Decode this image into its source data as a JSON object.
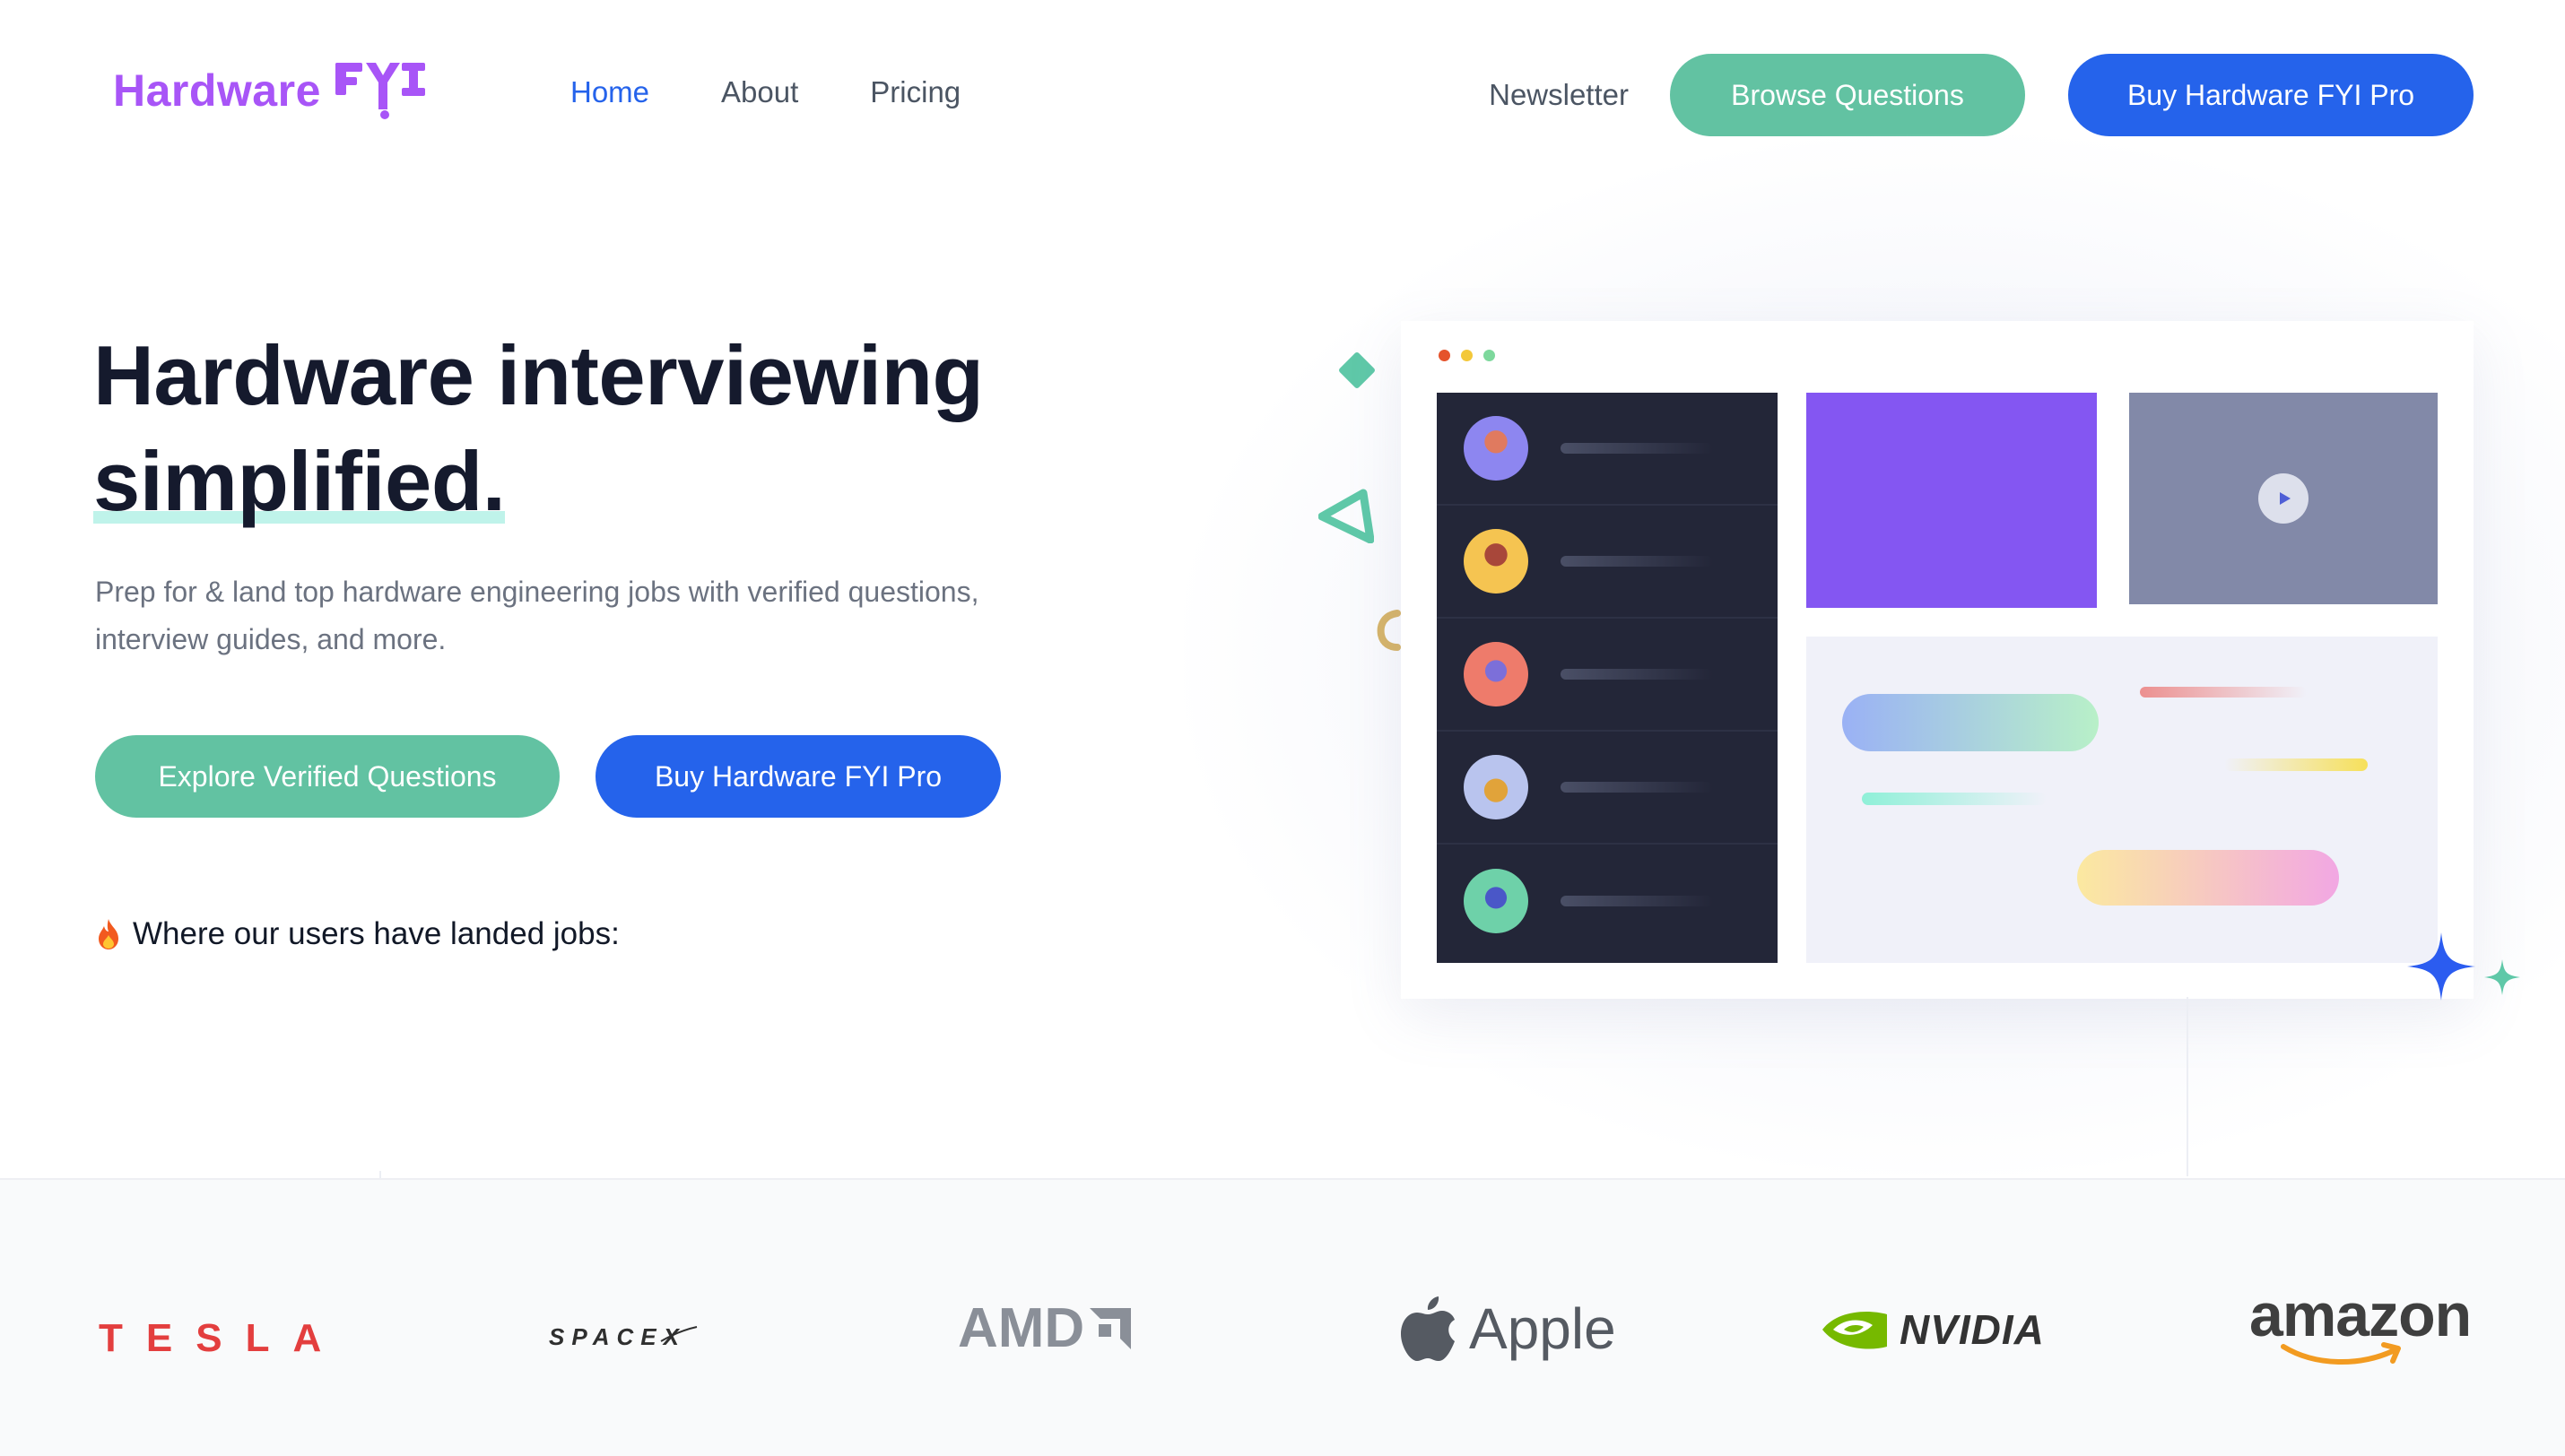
{
  "brand": {
    "logo_text": "Hardware",
    "logo_mark_text": "FYI",
    "color": "#a855f7"
  },
  "nav": {
    "items": [
      {
        "label": "Home",
        "active": true
      },
      {
        "label": "About",
        "active": false
      },
      {
        "label": "Pricing",
        "active": false
      }
    ]
  },
  "header": {
    "newsletter_label": "Newsletter",
    "browse_label": "Browse Questions",
    "buy_label": "Buy Hardware FYI Pro"
  },
  "hero": {
    "title_line1": "Hardware interviewing",
    "title_line2": "simplified.",
    "subtitle": "Prep for & land top hardware engineering jobs with verified questions, interview guides, and more.",
    "cta_primary": "Explore Verified Questions",
    "cta_secondary": "Buy Hardware FYI Pro",
    "landed_label": "Where our users have landed jobs:"
  },
  "companies": [
    {
      "name": "TESLA",
      "color": "#e33e3e"
    },
    {
      "name": "SPACEX",
      "color": "#2f2f2f"
    },
    {
      "name": "AMD",
      "color": "#8a8f98"
    },
    {
      "name": "Apple",
      "color": "#555a62"
    },
    {
      "name": "NVIDIA",
      "color": "#76b900"
    },
    {
      "name": "amazon",
      "color": "#3f3f3f"
    }
  ],
  "colors": {
    "accent_green": "#62c2a2",
    "accent_blue": "#2563eb",
    "mock_purple": "#8456f2",
    "mock_sidebar": "#232638"
  },
  "icons": [
    "fire-icon",
    "play-icon",
    "sparkle-icon",
    "apple-logo-icon",
    "nvidia-eye-icon",
    "amazon-smile-icon"
  ]
}
